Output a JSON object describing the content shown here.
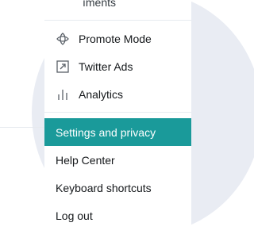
{
  "menu": {
    "top_partial_label": "ıments",
    "items": [
      {
        "label": "Promote Mode",
        "icon": "promote-mode-icon"
      },
      {
        "label": "Twitter Ads",
        "icon": "external-arrow-icon"
      },
      {
        "label": "Analytics",
        "icon": "bar-chart-icon"
      },
      {
        "label": "Settings and privacy"
      },
      {
        "label": "Help Center"
      },
      {
        "label": "Keyboard shortcuts"
      },
      {
        "label": "Log out"
      }
    ],
    "active_item": "Settings and privacy"
  },
  "colors": {
    "accent": "#1a9a9a",
    "background_circle": "#e9ecf3",
    "text": "#14171a",
    "icon": "#5a6068"
  }
}
